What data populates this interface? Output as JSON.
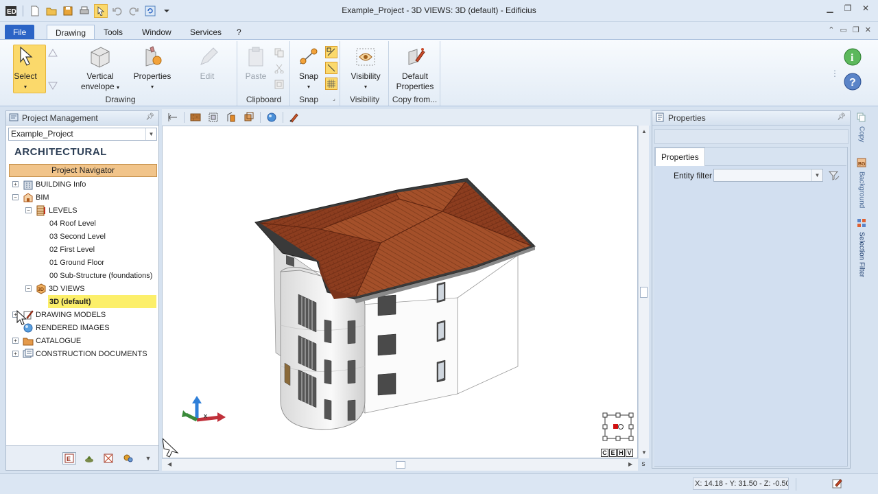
{
  "window": {
    "title": "Example_Project -  3D VIEWS: 3D (default) - Edificius"
  },
  "menu": {
    "file": "File",
    "tabs": [
      "Drawing",
      "Tools",
      "Window",
      "Services",
      "?"
    ]
  },
  "ribbon": {
    "select": "Select",
    "vertical_envelope_1": "Vertical",
    "vertical_envelope_2": "envelope",
    "properties": "Properties",
    "edit": "Edit",
    "paste": "Paste",
    "snap": "Snap",
    "visibility": "Visibility",
    "default_properties_1": "Default",
    "default_properties_2": "Properties",
    "groups": {
      "drawing": "Drawing",
      "clipboard": "Clipboard",
      "snap": "Snap",
      "visibility": "Visibility",
      "copy_from": "Copy from..."
    }
  },
  "left_panel": {
    "title": "Project Management",
    "project": "Example_Project",
    "section": "ARCHITECTURAL",
    "navigator": "Project Navigator",
    "tree": [
      {
        "label": "BUILDING Info",
        "expander": "+"
      },
      {
        "label": "BIM",
        "expander": "−"
      },
      {
        "label": "LEVELS",
        "expander": "−"
      },
      {
        "label": "04 Roof Level"
      },
      {
        "label": "03 Second Level"
      },
      {
        "label": "02 First Level"
      },
      {
        "label": "01 Ground Floor"
      },
      {
        "label": "00 Sub-Structure (foundations)"
      },
      {
        "label": "3D VIEWS",
        "expander": "−"
      },
      {
        "label": "3D (default)",
        "selected": true
      },
      {
        "label": "DRAWING MODELS",
        "expander": "+"
      },
      {
        "label": "RENDERED IMAGES"
      },
      {
        "label": "CATALOGUE",
        "expander": "+"
      },
      {
        "label": "CONSTRUCTION DOCUMENTS",
        "expander": "+"
      }
    ]
  },
  "viewport": {
    "axis_label": "x",
    "viewcube_labels": [
      "C",
      "E",
      "H",
      "V"
    ],
    "scroll_corner": "s"
  },
  "right_panel": {
    "title": "Properties",
    "tab": "Properties",
    "entity_filter_label": "Entity filter",
    "entity_filter_value": ""
  },
  "side_tabs": [
    "Copy",
    "Background",
    "Selection Filter"
  ],
  "status": {
    "coords": "X: 14.18 - Y: 31.50 - Z: -0.50"
  },
  "colors": {
    "file_tab": "#2b64c6",
    "select_highlight": "#fbd96b",
    "navigator_header": "#f1c48a",
    "tree_selected": "#fcef6a",
    "roof": "#8b3a1e"
  }
}
